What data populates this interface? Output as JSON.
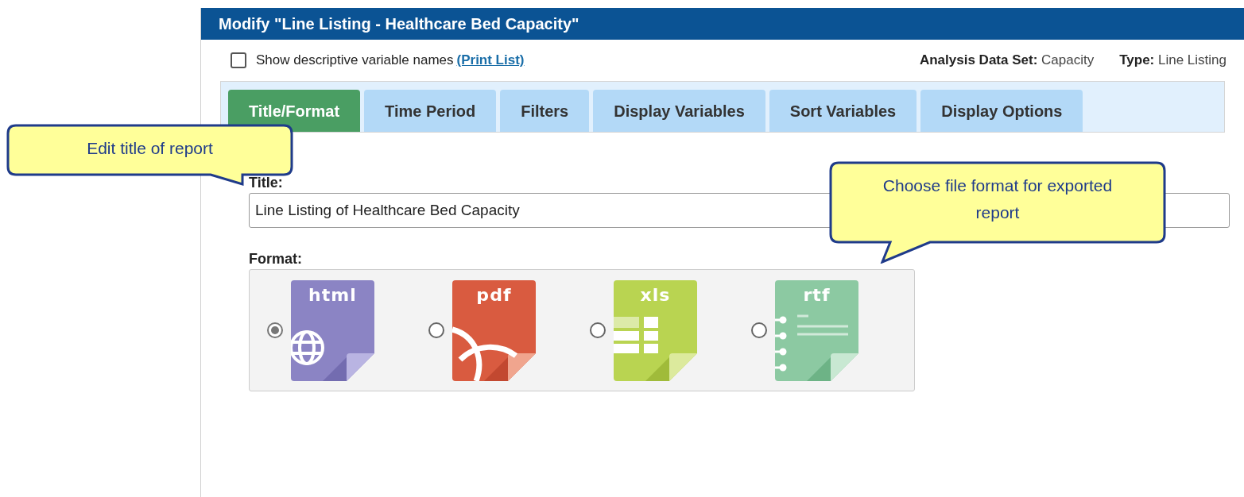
{
  "window": {
    "title": "Modify \"Line Listing - Healthcare Bed Capacity\""
  },
  "options": {
    "show_descriptive": {
      "label": "Show descriptive variable names",
      "checked": false
    },
    "print_link": "(Print List)"
  },
  "info": [
    {
      "label": "Analysis Data Set:",
      "value": "Capacity"
    },
    {
      "label": "Type:",
      "value": "Line Listing"
    }
  ],
  "tabs": [
    {
      "label": "Title/Format",
      "selected": true
    },
    {
      "label": "Time Period",
      "selected": false
    },
    {
      "label": "Filters",
      "selected": false
    },
    {
      "label": "Display Variables",
      "selected": false
    },
    {
      "label": "Sort Variables",
      "selected": false
    },
    {
      "label": "Display Options",
      "selected": false
    }
  ],
  "title_field": {
    "label": "Title:",
    "value": "Line Listing of Healthcare Bed Capacity"
  },
  "format": {
    "label": "Format:",
    "options": [
      {
        "kind": "html",
        "text": "html",
        "selected": true
      },
      {
        "kind": "pdf",
        "text": "pdf",
        "selected": false
      },
      {
        "kind": "xls",
        "text": "xls",
        "selected": false
      },
      {
        "kind": "rtf",
        "text": "rtf",
        "selected": false
      }
    ]
  },
  "callouts": [
    {
      "text": "Edit title of report"
    },
    {
      "text": "Choose file format for exported report"
    }
  ]
}
